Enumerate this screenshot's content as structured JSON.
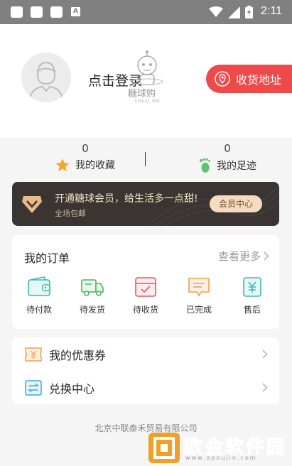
{
  "status_bar": {
    "time": "2:11",
    "notif_a": "A"
  },
  "profile": {
    "login_label": "点击登录",
    "logo_cn": "糖球购",
    "logo_en": "LOLLI GO",
    "address_label": "收货地址"
  },
  "stats": {
    "favorites": {
      "count": "0",
      "label": "我的收藏"
    },
    "footprints": {
      "count": "0",
      "label": "我的足迹"
    }
  },
  "member": {
    "title": "开通糖球会员，给生活多一点甜!",
    "subtitle": "全场包邮",
    "button": "会员中心"
  },
  "orders": {
    "title": "我的订单",
    "more": "查看更多",
    "items": [
      {
        "label": "待付款",
        "icon": "wallet-icon"
      },
      {
        "label": "待发货",
        "icon": "truck-icon"
      },
      {
        "label": "待收货",
        "icon": "box-icon"
      },
      {
        "label": "已完成",
        "icon": "message-icon"
      },
      {
        "label": "售后",
        "icon": "yen-icon"
      }
    ]
  },
  "menu": {
    "coupons": "我的优惠券",
    "exchange": "兑换中心"
  },
  "footer": {
    "company": "北京中联泰禾贸易有限公司"
  },
  "watermark": {
    "text": "欧金软件园",
    "url": "www.apoujin.com"
  },
  "colors": {
    "accent": "#f0494a",
    "member_bg": "#3a3532",
    "member_gold": "#f3e1c5"
  }
}
